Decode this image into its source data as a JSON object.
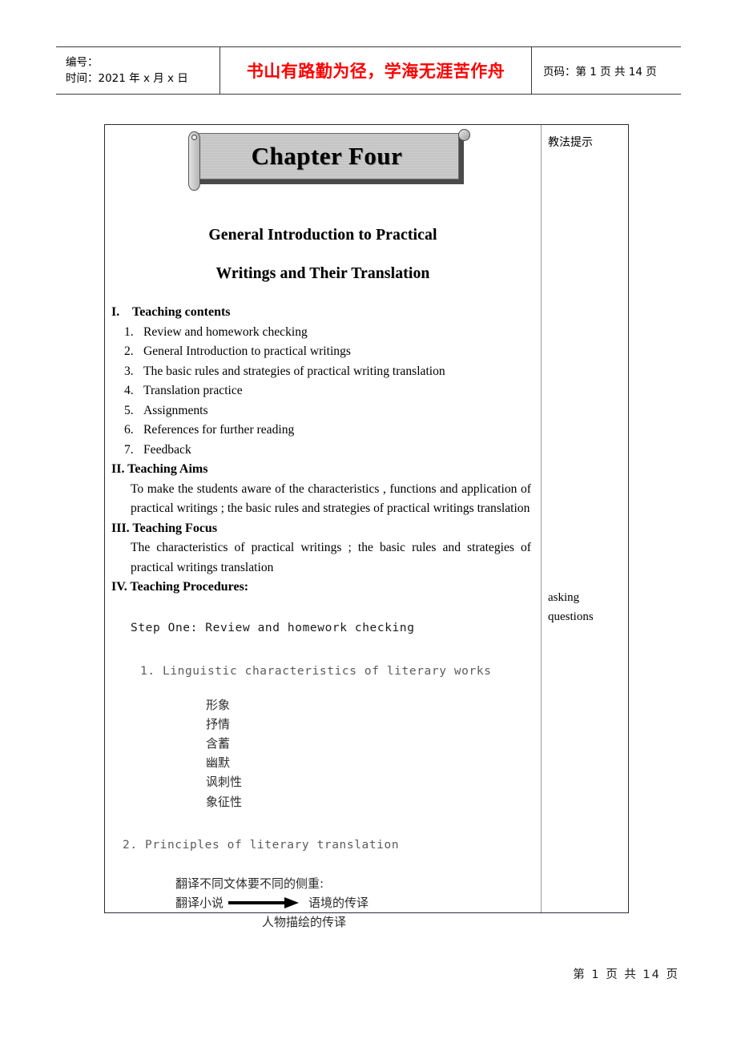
{
  "header": {
    "label_number": "编号：",
    "label_time": "时间：2021 年 x 月 x 日",
    "motto": "书山有路勤为径，学海无涯苦作舟",
    "motto_color": "#ff0000",
    "page_label": "页码：第 1 页 共 14 页"
  },
  "banner": {
    "title": "Chapter Four"
  },
  "subtitle": {
    "line1": "General Introduction to Practical",
    "line2": "Writings and Their Translation"
  },
  "sections": {
    "s1_numeral": "I.",
    "s1_title": "Teaching contents",
    "s1_items": [
      {
        "idx": "1.",
        "text": "Review and homework checking"
      },
      {
        "idx": "2.",
        "text": "General Introduction to practical writings"
      },
      {
        "idx": "3.",
        "text": "The   basic rules and strategies of practical writing translation"
      },
      {
        "idx": "4.",
        "text": "Translation practice"
      },
      {
        "idx": "5.",
        "text": "Assignments"
      },
      {
        "idx": "6.",
        "text": " References for further reading"
      },
      {
        "idx": "7.",
        "text": "Feedback"
      }
    ],
    "s2_title": "II. Teaching Aims",
    "s2_body": "To make the students aware of the characteristics , functions and application of practical writings ; the basic rules and strategies of practical writings translation",
    "s3_title": "III. Teaching Focus",
    "s3_body": "The characteristics of practical writings ; the basic rules and strategies of practical writings translation",
    "s4_title": "IV. Teaching Procedures:"
  },
  "procedures": {
    "step_one": "Step One:  Review and homework checking",
    "item1": "1. Linguistic characteristics of literary works",
    "cn_terms": [
      "形象",
      "抒情",
      "含蓄",
      "幽默",
      "讽刺性",
      "象征性"
    ],
    "item2": "2. Principles of literary translation",
    "cn_note": "翻译不同文体要不同的侧重:",
    "cn_arrow_left": "翻译小说",
    "cn_arrow_right": "语境的传译",
    "cn_arrow_right2": "人物描绘的传译"
  },
  "notes": {
    "heading": "教法提示",
    "asking_line1": "asking",
    "asking_line2": "questions"
  },
  "footer": {
    "page_text": "第 1 页 共 14 页"
  }
}
